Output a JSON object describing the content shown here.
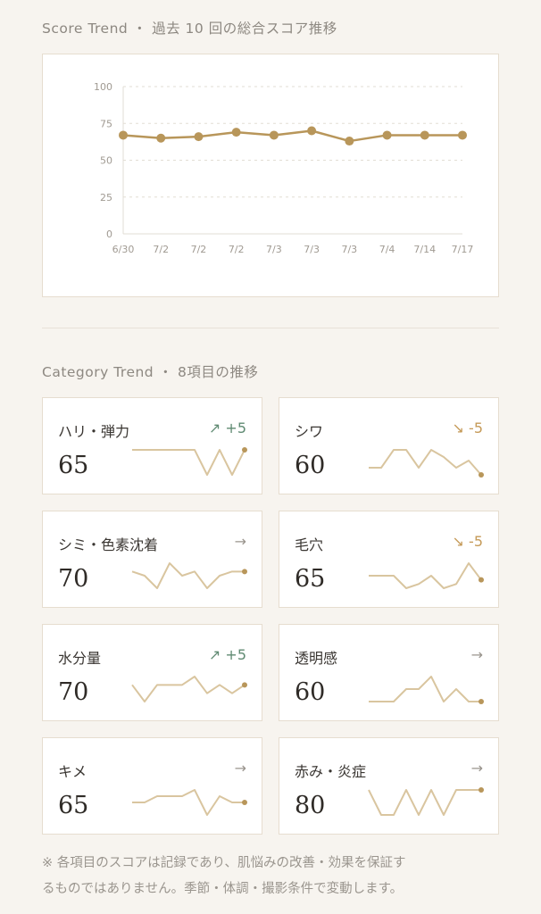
{
  "score_trend": {
    "title": "Score Trend ・ 過去 10 回の総合スコア推移"
  },
  "chart_data": {
    "type": "line",
    "title": "Score Trend ・ 過去 10 回の総合スコア推移",
    "categories": [
      "6/30",
      "7/2",
      "7/2",
      "7/2",
      "7/3",
      "7/3",
      "7/3",
      "7/4",
      "7/14",
      "7/17"
    ],
    "values": [
      67,
      65,
      66,
      69,
      67,
      70,
      63,
      67,
      67,
      67
    ],
    "yticks": [
      "0",
      "25",
      "50",
      "75",
      "100"
    ],
    "ylim": [
      0,
      100
    ],
    "grid": true,
    "color": "#b8965a"
  },
  "category_trend": {
    "title": "Category Trend ・ 8項目の推移",
    "items": [
      {
        "label": "ハリ・弾力",
        "delta": "↗ +5",
        "direction": "up",
        "score": "65",
        "spark": [
          65,
          65,
          65,
          65,
          65,
          65,
          60,
          65,
          60,
          65
        ]
      },
      {
        "label": "シワ",
        "delta": "↘ -5",
        "direction": "down",
        "score": "60",
        "spark": [
          60,
          60,
          65,
          65,
          60,
          65,
          63,
          60,
          62,
          58
        ]
      },
      {
        "label": "シミ・色素沈着",
        "delta": "→",
        "direction": "flat",
        "score": "70",
        "spark": [
          70,
          69,
          66,
          72,
          69,
          70,
          66,
          69,
          70,
          70
        ]
      },
      {
        "label": "毛穴",
        "delta": "↘ -5",
        "direction": "down",
        "score": "65",
        "spark": [
          65,
          65,
          65,
          62,
          63,
          65,
          62,
          63,
          68,
          64
        ]
      },
      {
        "label": "水分量",
        "delta": "↗ +5",
        "direction": "up",
        "score": "70",
        "spark": [
          70,
          66,
          70,
          70,
          70,
          72,
          68,
          70,
          68,
          70
        ]
      },
      {
        "label": "透明感",
        "delta": "→",
        "direction": "flat",
        "score": "60",
        "spark": [
          60,
          60,
          60,
          62,
          62,
          64,
          60,
          62,
          60,
          60
        ]
      },
      {
        "label": "キメ",
        "delta": "→",
        "direction": "flat",
        "score": "65",
        "spark": [
          65,
          65,
          66,
          66,
          66,
          67,
          63,
          66,
          65,
          65
        ]
      },
      {
        "label": "赤み・炎症",
        "delta": "→",
        "direction": "flat",
        "score": "80",
        "spark": [
          80,
          78,
          78,
          80,
          78,
          80,
          78,
          80,
          80,
          80
        ]
      }
    ]
  },
  "footnote": {
    "line1": "※ 各項目のスコアは記録であり、肌悩みの改善・効果を保証す",
    "line2": "るものではありません。季節・体調・撮影条件で変動します。"
  }
}
